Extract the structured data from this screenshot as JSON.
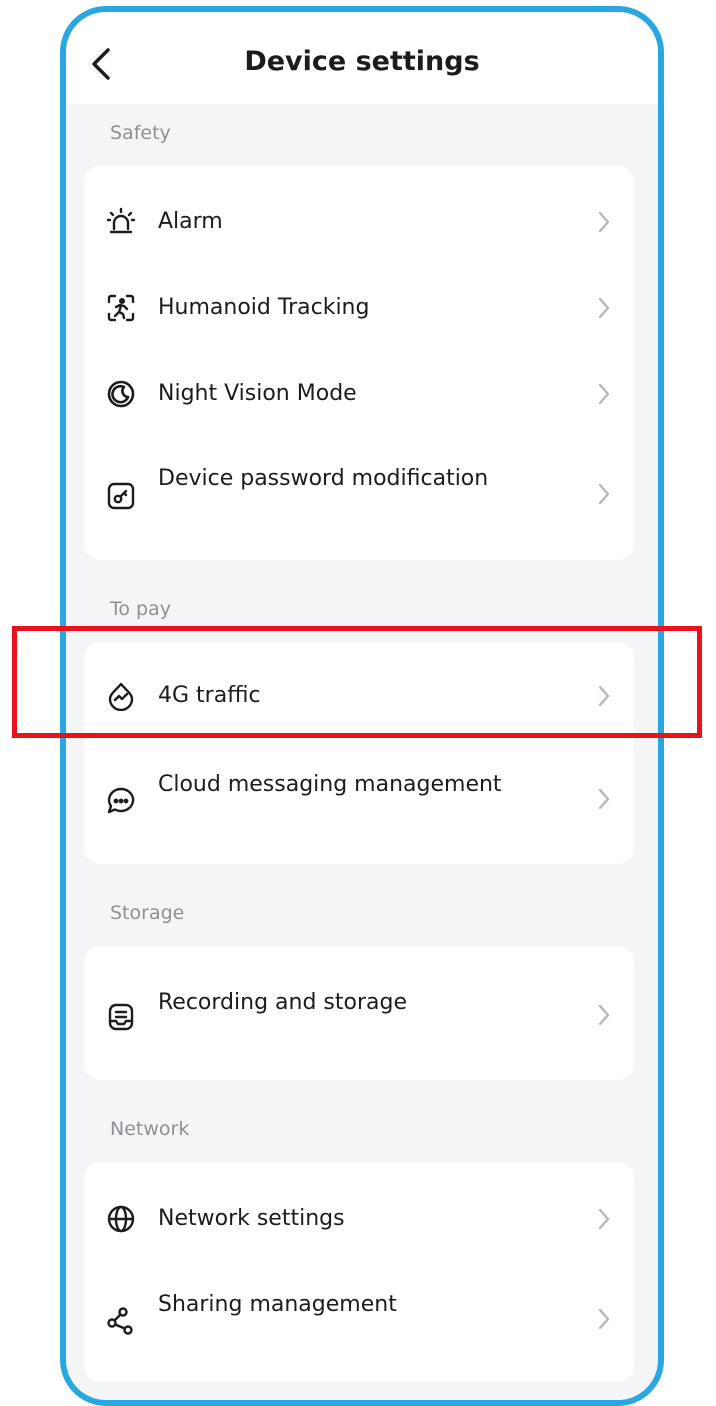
{
  "header": {
    "title": "Device settings",
    "back_icon": "chevron-left-icon"
  },
  "sections": [
    {
      "title": "Safety",
      "items": [
        {
          "label": "Alarm",
          "icon": "alarm-siren-icon"
        },
        {
          "label": "Humanoid Tracking",
          "icon": "humanoid-tracking-icon"
        },
        {
          "label": "Night Vision Mode",
          "icon": "night-vision-icon"
        },
        {
          "label": "Device password modification",
          "icon": "password-key-icon"
        }
      ]
    },
    {
      "title": "To pay",
      "items": [
        {
          "label": "4G traffic",
          "icon": "traffic-drop-icon"
        },
        {
          "label": "Cloud messaging management",
          "icon": "chat-bubble-icon"
        }
      ]
    },
    {
      "title": "Storage",
      "items": [
        {
          "label": "Recording and storage",
          "icon": "storage-icon"
        }
      ]
    },
    {
      "title": "Network",
      "items": [
        {
          "label": "Network settings",
          "icon": "globe-icon"
        },
        {
          "label": "Sharing management",
          "icon": "share-icon"
        }
      ]
    }
  ],
  "colors": {
    "frame_border": "#29a7e1",
    "highlight": "#e8131a",
    "background": "#f4f5f7",
    "card": "#ffffff",
    "text": "#1c1c1e",
    "section_text": "#8e9096",
    "chevron": "#b5b7bc"
  }
}
